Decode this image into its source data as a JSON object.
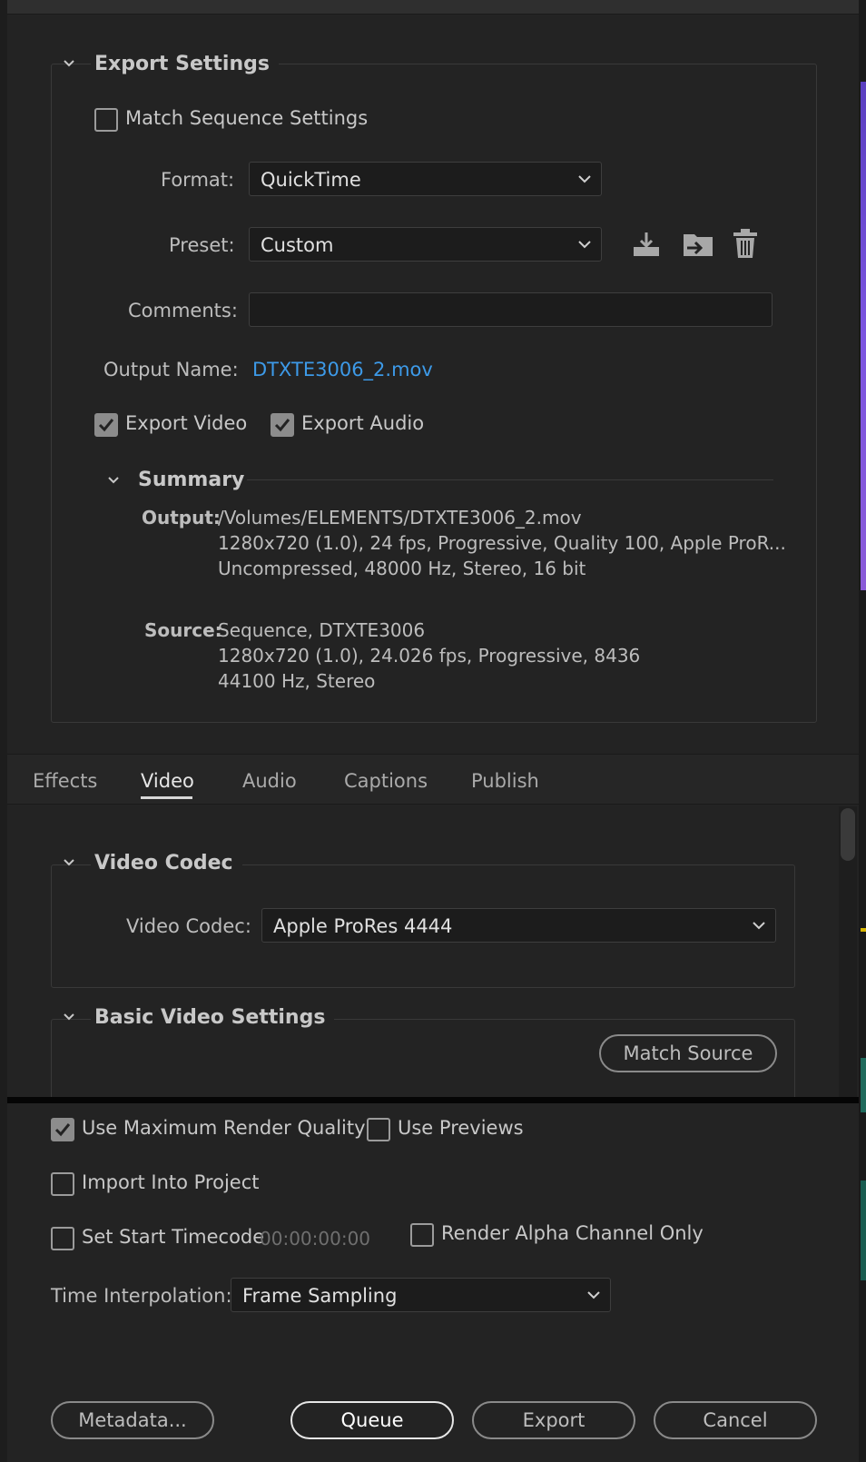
{
  "export_settings": {
    "title": "Export Settings",
    "match_sequence_label": "Match Sequence Settings",
    "match_sequence_checked": false,
    "format_label": "Format:",
    "format_value": "QuickTime",
    "preset_label": "Preset:",
    "preset_value": "Custom",
    "comments_label": "Comments:",
    "comments_value": "",
    "output_name_label": "Output Name:",
    "output_name_value": "DTXTE3006_2.mov",
    "export_video_label": "Export Video",
    "export_video_checked": true,
    "export_audio_label": "Export Audio",
    "export_audio_checked": true
  },
  "summary": {
    "title": "Summary",
    "output_key": "Output:",
    "output_lines": [
      "/Volumes/ELEMENTS/DTXTE3006_2.mov",
      "1280x720 (1.0), 24 fps, Progressive, Quality 100, Apple ProR...",
      "Uncompressed, 48000 Hz, Stereo, 16 bit"
    ],
    "source_key": "Source:",
    "source_lines": [
      "Sequence, DTXTE3006",
      "1280x720 (1.0), 24.026 fps, Progressive, 8436",
      "44100 Hz, Stereo"
    ]
  },
  "tabs": [
    {
      "label": "Effects",
      "active": false
    },
    {
      "label": "Video",
      "active": true
    },
    {
      "label": "Audio",
      "active": false
    },
    {
      "label": "Captions",
      "active": false
    },
    {
      "label": "Publish",
      "active": false
    }
  ],
  "video_codec": {
    "title": "Video Codec",
    "label": "Video Codec:",
    "value": "Apple ProRes 4444"
  },
  "basic_video": {
    "title": "Basic Video Settings",
    "match_source_label": "Match Source"
  },
  "options": {
    "max_render_label": "Use Maximum Render Quality",
    "max_render_checked": true,
    "use_previews_label": "Use Previews",
    "use_previews_checked": false,
    "import_project_label": "Import Into Project",
    "import_project_checked": false,
    "start_timecode_label": "Set Start Timecode",
    "start_timecode_checked": false,
    "start_timecode_value": "00:00:00:00",
    "alpha_only_label": "Render Alpha Channel Only",
    "alpha_only_checked": false,
    "time_interp_label": "Time Interpolation:",
    "time_interp_value": "Frame Sampling"
  },
  "buttons": {
    "metadata": "Metadata...",
    "queue": "Queue",
    "export": "Export",
    "cancel": "Cancel"
  },
  "icons": {
    "save_preset": "save-preset-icon",
    "import_preset": "import-preset-icon",
    "delete_preset": "trash-icon"
  },
  "colors": {
    "background": "#232323",
    "link": "#3d9ae8"
  }
}
